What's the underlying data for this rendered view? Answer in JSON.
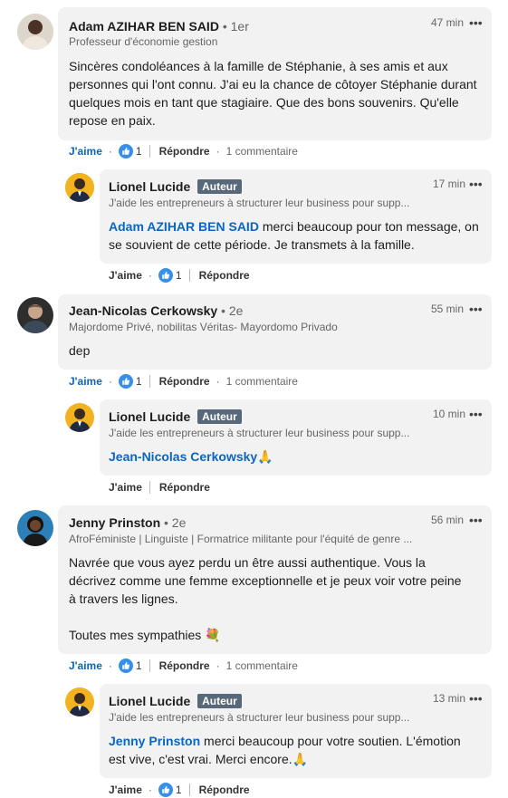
{
  "ui": {
    "more_label": "•••",
    "separator": "·"
  },
  "comments": [
    {
      "author": "Adam AZIHAR BEN SAID",
      "degree": "• 1er",
      "headline": "Professeur d'économie gestion",
      "time": "47 min",
      "text": "Sincères condoléances à la famille de Stéphanie, à ses amis et aux personnes qui l'ont connu. J'ai eu la chance de côtoyer Stéphanie durant quelques mois en tant que stagiaire. Que des bons souvenirs. Qu'elle repose en paix.",
      "like_label": "J'aime",
      "reactions": "1",
      "reply_label": "Répondre",
      "comments_label": "1 commentaire",
      "reply": {
        "author": "Lionel Lucide",
        "badge": "Auteur",
        "headline": "J'aide les entrepreneurs à structurer leur business pour supp...",
        "time": "17 min",
        "mention": "Adam AZIHAR BEN SAID",
        "text": " merci beaucoup pour ton message, on se souvient de cette période. Je transmets à la famille.",
        "like_label": "J'aime",
        "reactions": "1",
        "reply_label": "Répondre"
      }
    },
    {
      "author": "Jean-Nicolas Cerkowsky",
      "degree": "• 2e",
      "headline": "Majordome Privé, nobilitas Véritas- Mayordomo Privado",
      "time": "55 min",
      "text": "dep",
      "like_label": "J'aime",
      "reactions": "1",
      "reply_label": "Répondre",
      "comments_label": "1 commentaire",
      "reply": {
        "author": "Lionel Lucide",
        "badge": "Auteur",
        "headline": "J'aide les entrepreneurs à structurer leur business pour supp...",
        "time": "10 min",
        "mention": "Jean-Nicolas Cerkowsky",
        "text": "🙏",
        "like_label": "J'aime",
        "reply_label": "Répondre"
      }
    },
    {
      "author": "Jenny Prinston",
      "degree": "• 2e",
      "headline": "AfroFéministe | Linguiste | Formatrice militante pour l'équité de genre ...",
      "time": "56 min",
      "text_lines": "Navrée que vous ayez perdu un être aussi authentique. Vous la décrivez comme une femme exceptionnelle et je peux voir votre peine à travers les lignes.",
      "text_tail": "Toutes mes sympathies 💐",
      "like_label": "J'aime",
      "reactions": "1",
      "reply_label": "Répondre",
      "comments_label": "1 commentaire",
      "reply": {
        "author": "Lionel Lucide",
        "badge": "Auteur",
        "headline": "J'aide les entrepreneurs à structurer leur business pour supp...",
        "time": "13 min",
        "mention": "Jenny Prinston",
        "text": " merci beaucoup pour votre soutien. L'émotion est vive, c'est vrai. Merci encore.🙏",
        "like_label": "J'aime",
        "reactions": "1",
        "reply_label": "Répondre"
      }
    }
  ]
}
